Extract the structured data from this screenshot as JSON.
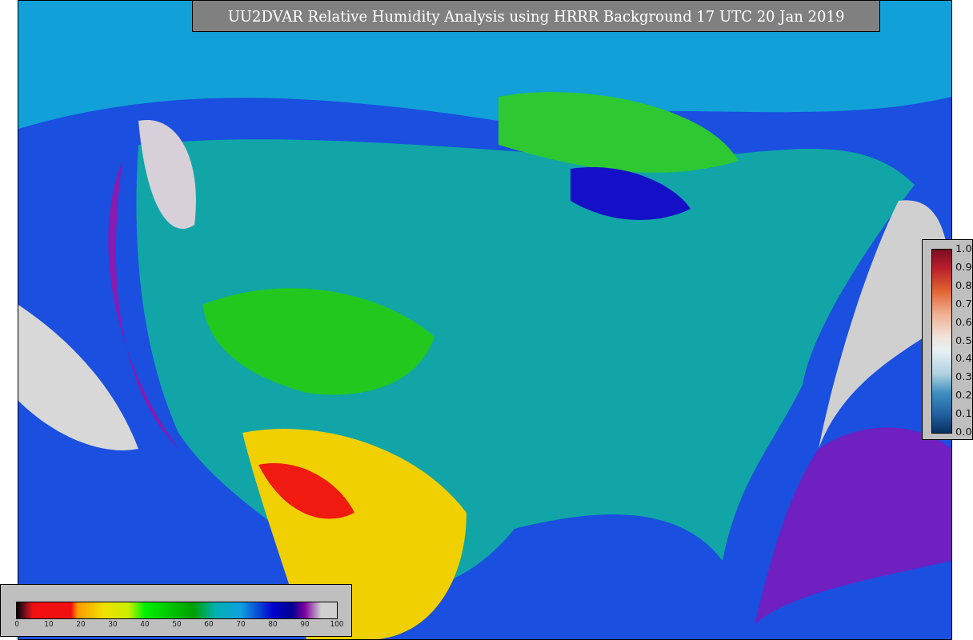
{
  "title": "UU2DVAR Relative Humidity Analysis using HRRR Background 17 UTC 20 Jan 2019",
  "humidity_colorbar": {
    "ticks": [
      "0",
      "10",
      "20",
      "30",
      "40",
      "50",
      "60",
      "70",
      "80",
      "90",
      "100"
    ]
  },
  "observation_colorbar": {
    "ticks": [
      "1.0",
      "0.9",
      "0.8",
      "0.7",
      "0.6",
      "0.5",
      "0.4",
      "0.3",
      "0.2",
      "0.1",
      "0.0"
    ]
  }
}
